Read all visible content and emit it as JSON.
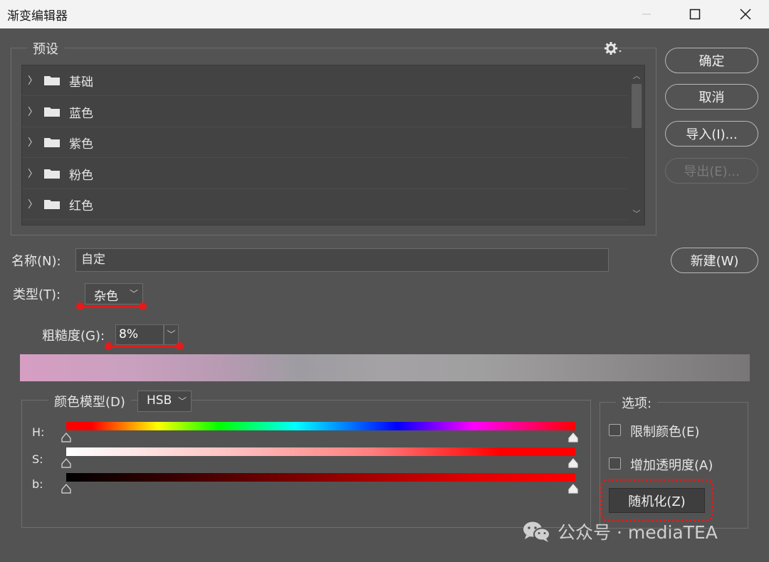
{
  "window": {
    "title": "渐变编辑器"
  },
  "presets": {
    "group_label": "预设",
    "items": [
      "基础",
      "蓝色",
      "紫色",
      "粉色",
      "红色"
    ]
  },
  "buttons": {
    "ok": "确定",
    "cancel": "取消",
    "import": "导入(I)...",
    "export": "导出(E)...",
    "new": "新建(W)"
  },
  "name_field": {
    "label": "名称(N):",
    "value": "自定"
  },
  "type_field": {
    "label": "类型(T):",
    "value": "杂色"
  },
  "roughness_field": {
    "label": "粗糙度(G):",
    "value": "8%"
  },
  "color_model": {
    "label": "颜色模型(D)",
    "value": "HSB",
    "sliders": [
      {
        "label": "H:"
      },
      {
        "label": "S:"
      },
      {
        "label": "b:"
      }
    ]
  },
  "options": {
    "group_label": "选项:",
    "restrict_colors": "限制颜色(E)",
    "add_transparency": "增加透明度(A)",
    "randomize": "随机化(Z)"
  },
  "watermark": {
    "text": "公众号 · mediaTEA"
  },
  "colors": {
    "background": "#535353",
    "annotation_red": "#e21b1b"
  }
}
